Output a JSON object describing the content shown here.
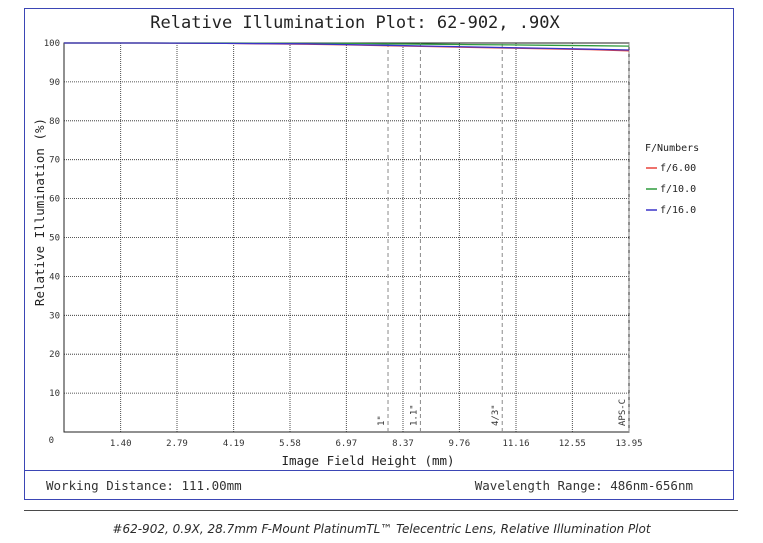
{
  "caption": "#62-902, 0.9X, 28.7mm F-Mount PlatinumTL™ Telecentric Lens, Relative Illumination Plot",
  "info": {
    "working_distance": "Working Distance: 111.00mm",
    "wavelength_range": "Wavelength Range: 486nm-656nm"
  },
  "colors": {
    "frame": "#3b46b5",
    "grid": "#222222",
    "marker": "#8a8a8a"
  },
  "chart_data": {
    "type": "line",
    "title": "Relative Illumination Plot: 62-902, .90X",
    "xlabel": "Image Field Height (mm)",
    "ylabel": "Relative Illumination (%)",
    "xlim": [
      0,
      13.95
    ],
    "ylim": [
      0,
      100
    ],
    "x_ticks": [
      {
        "v": 1.4,
        "label": "1.40"
      },
      {
        "v": 2.79,
        "label": "2.79"
      },
      {
        "v": 4.19,
        "label": "4.19"
      },
      {
        "v": 5.58,
        "label": "5.58"
      },
      {
        "v": 6.97,
        "label": "6.97"
      },
      {
        "v": 8.37,
        "label": "8.37"
      },
      {
        "v": 9.76,
        "label": "9.76"
      },
      {
        "v": 11.16,
        "label": "11.16"
      },
      {
        "v": 12.55,
        "label": "12.55"
      },
      {
        "v": 13.95,
        "label": "13.95"
      }
    ],
    "x_origin_label": "0",
    "y_ticks": [
      {
        "v": 10,
        "label": "10"
      },
      {
        "v": 20,
        "label": "20"
      },
      {
        "v": 30,
        "label": "30"
      },
      {
        "v": 40,
        "label": "40"
      },
      {
        "v": 50,
        "label": "50"
      },
      {
        "v": 60,
        "label": "60"
      },
      {
        "v": 70,
        "label": "70"
      },
      {
        "v": 80,
        "label": "80"
      },
      {
        "v": 90,
        "label": "90"
      },
      {
        "v": 100,
        "label": "100"
      }
    ],
    "grid": true,
    "legend": {
      "title": "F/Numbers",
      "placement": "right"
    },
    "sensor_markers": [
      {
        "x": 8.0,
        "label": "1\""
      },
      {
        "x": 8.8,
        "label": "1.1\""
      },
      {
        "x": 10.82,
        "label": "4/3\""
      },
      {
        "x": 13.95,
        "label": "APS-C"
      }
    ],
    "series": [
      {
        "name": "f/6.00",
        "color": "#e8423b",
        "x": [
          0,
          2,
          4,
          6,
          7,
          8,
          9,
          10,
          11,
          12,
          13,
          13.95
        ],
        "y": [
          100,
          100,
          99.9,
          99.7,
          99.5,
          99.3,
          99.1,
          98.9,
          98.7,
          98.5,
          98.3,
          98.0
        ]
      },
      {
        "name": "f/10.0",
        "color": "#2e9a3c",
        "x": [
          0,
          2,
          4,
          6,
          7,
          8,
          9,
          10,
          11,
          12,
          13,
          13.95
        ],
        "y": [
          100,
          100,
          100,
          99.9,
          99.9,
          99.8,
          99.7,
          99.6,
          99.5,
          99.4,
          99.3,
          99.2
        ]
      },
      {
        "name": "f/16.0",
        "color": "#3a34c8",
        "x": [
          0,
          2,
          4,
          6,
          7,
          8,
          9,
          10,
          11,
          12,
          13,
          13.95
        ],
        "y": [
          100,
          100,
          99.9,
          99.8,
          99.6,
          99.4,
          99.2,
          99.0,
          98.8,
          98.6,
          98.4,
          98.2
        ]
      }
    ]
  }
}
